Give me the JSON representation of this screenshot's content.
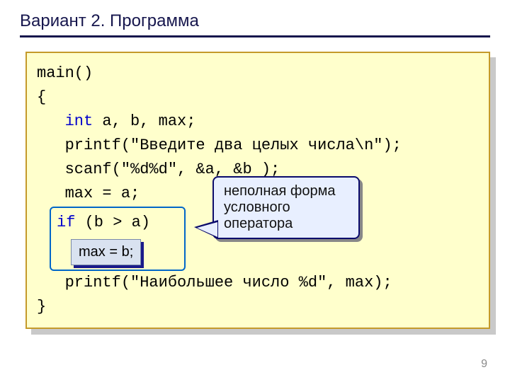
{
  "title": "Вариант 2. Программа",
  "code": {
    "l1": "main()",
    "l2": "{",
    "l3_indent": "   ",
    "l3_kw": "int",
    "l3_rest": " a, b, max;",
    "l4": "   printf(\"Введите два целых числа\\n\");",
    "l5": "   scanf(\"%d%d\", &a, &b );",
    "l6": "   max = a;",
    "if_kw": "if",
    "if_cond": " (b > a)",
    "maxb": "max = b;",
    "l8": "   printf(\"Наибольшее число %d\", max);",
    "l9": "}"
  },
  "callout": {
    "line1": "неполная форма",
    "line2": "условного",
    "line3": "оператора"
  },
  "page_number": "9"
}
